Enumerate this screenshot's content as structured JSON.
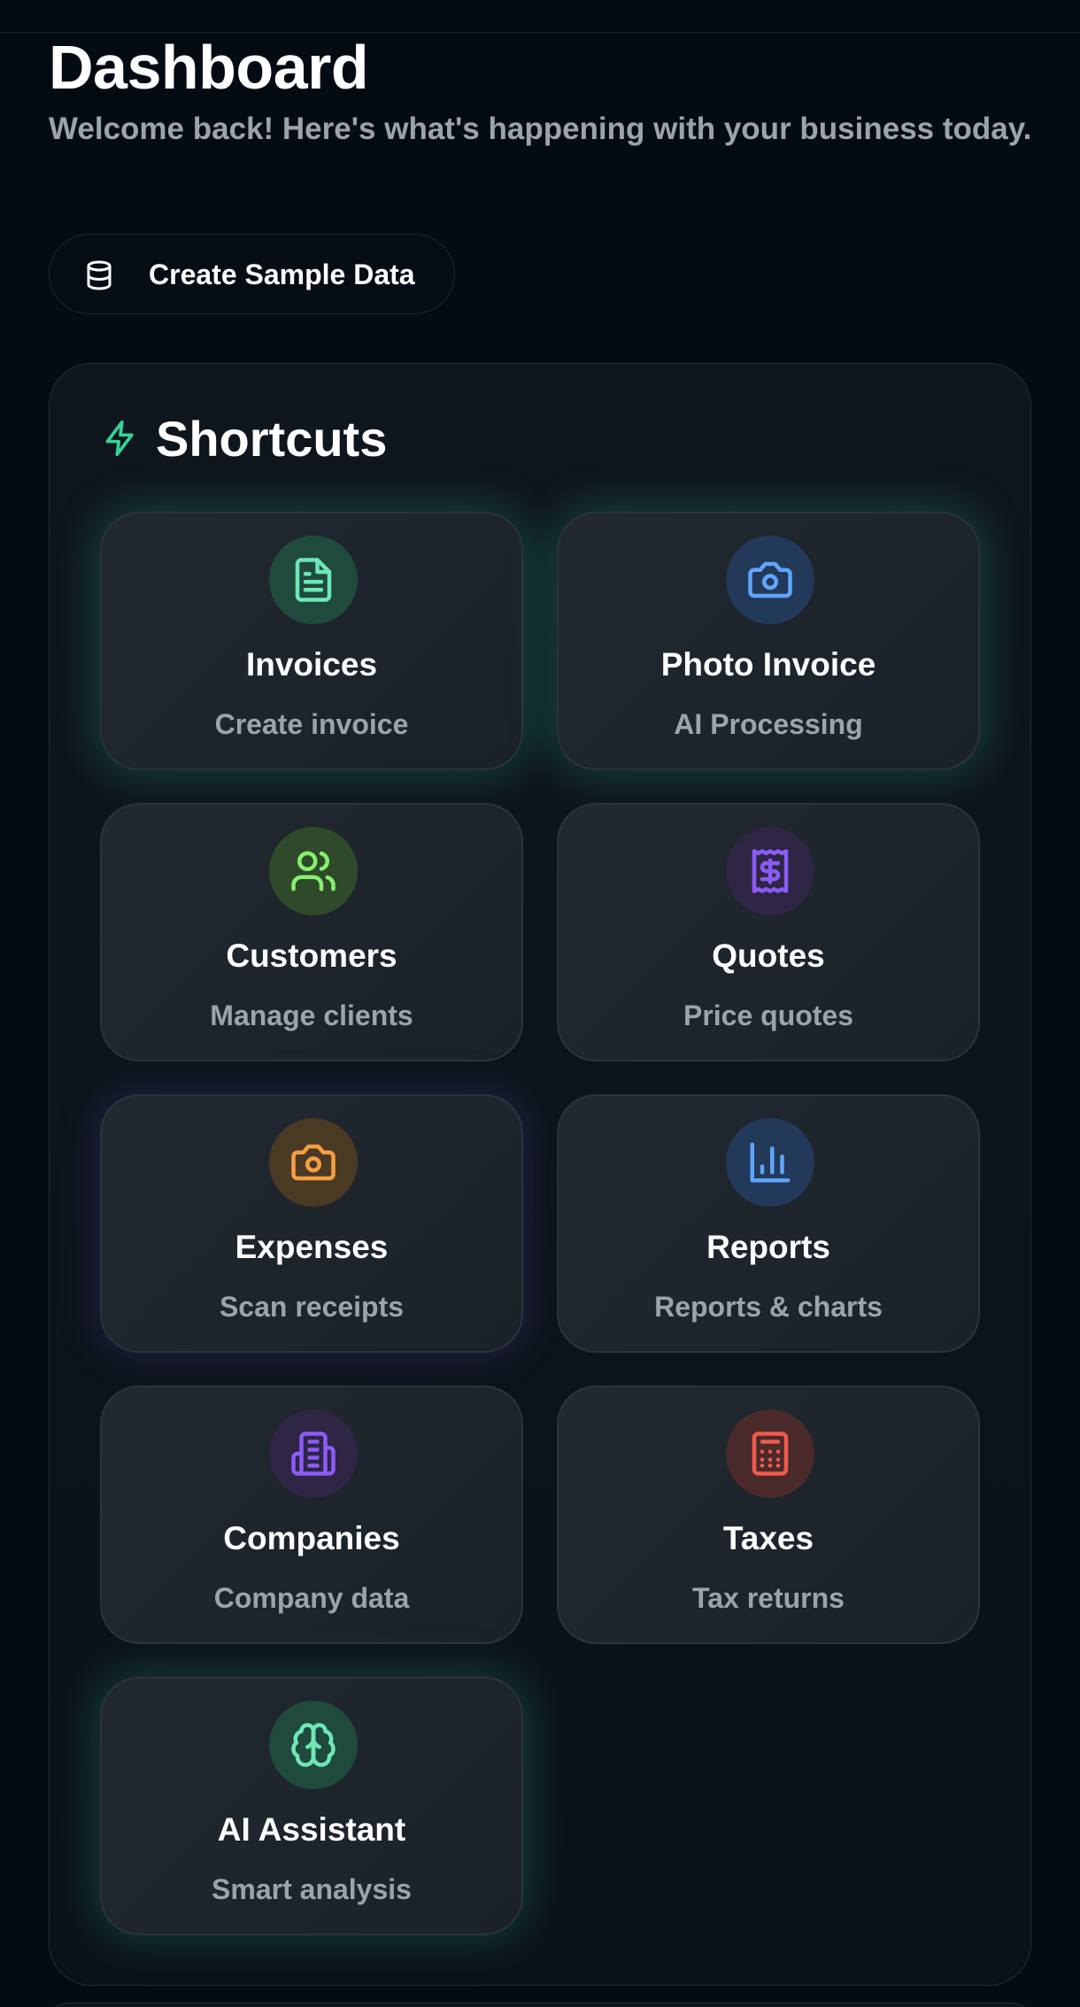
{
  "header": {
    "title": "Dashboard",
    "subtitle": "Welcome back! Here's what's happening with your business today."
  },
  "sample_button": {
    "label": "Create Sample Data",
    "icon": "database-icon"
  },
  "shortcuts": {
    "title": "Shortcuts",
    "icon": "zap-icon",
    "accent": "#34d399",
    "items": [
      {
        "title": "Invoices",
        "subtitle": "Create invoice",
        "icon": "file-text-icon",
        "color": "#6ee7b7",
        "bg": "#1f4a3c"
      },
      {
        "title": "Photo Invoice",
        "subtitle": "AI Processing",
        "icon": "camera-icon",
        "color": "#60a5fa",
        "bg": "#23395a"
      },
      {
        "title": "Customers",
        "subtitle": "Manage clients",
        "icon": "users-icon",
        "color": "#86ef6c",
        "bg": "#2f4a2a"
      },
      {
        "title": "Quotes",
        "subtitle": "Price quotes",
        "icon": "receipt-icon",
        "color": "#8b5cf6",
        "bg": "#2f2545"
      },
      {
        "title": "Expenses",
        "subtitle": "Scan receipts",
        "icon": "camera-icon",
        "color": "#f59e42",
        "bg": "#4a3a24"
      },
      {
        "title": "Reports",
        "subtitle": "Reports & charts",
        "icon": "bar-chart-icon",
        "color": "#60a5fa",
        "bg": "#23395a"
      },
      {
        "title": "Companies",
        "subtitle": "Company data",
        "icon": "building-icon",
        "color": "#8b5cf6",
        "bg": "#2f2545"
      },
      {
        "title": "Taxes",
        "subtitle": "Tax returns",
        "icon": "calculator-icon",
        "color": "#ef5b4c",
        "bg": "#4a2a2a"
      },
      {
        "title": "AI Assistant",
        "subtitle": "Smart analysis",
        "icon": "brain-icon",
        "color": "#6ee7b7",
        "bg": "#1f4a3c"
      }
    ]
  }
}
